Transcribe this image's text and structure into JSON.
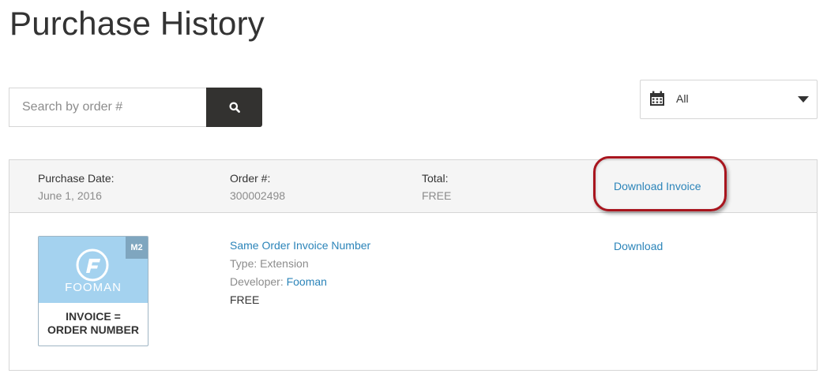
{
  "page": {
    "title": "Purchase History"
  },
  "search": {
    "placeholder": "Search by order #",
    "value": "",
    "button_icon": "search-icon"
  },
  "filter": {
    "icon": "calendar-icon",
    "selected": "All"
  },
  "order": {
    "purchase_date_label": "Purchase Date:",
    "purchase_date": "June 1, 2016",
    "order_number_label": "Order #:",
    "order_number": "300002498",
    "total_label": "Total:",
    "total": "FREE",
    "download_invoice_label": "Download Invoice",
    "highlight_color": "#a8151e",
    "items": [
      {
        "name": "Same Order Invoice Number",
        "type_label": "Type:",
        "type": "Extension",
        "developer_label": "Developer:",
        "developer": "Fooman",
        "price": "FREE",
        "download_label": "Download",
        "thumbnail": {
          "badge": "M2",
          "brand": "FOOMAN",
          "caption_line1": "INVOICE =",
          "caption_line2": "ORDER NUMBER"
        }
      }
    ]
  },
  "colors": {
    "link": "#2b84b9",
    "button_dark": "#333230",
    "thumb_blue": "#a4d2ef",
    "header_bg": "#f5f5f5"
  }
}
